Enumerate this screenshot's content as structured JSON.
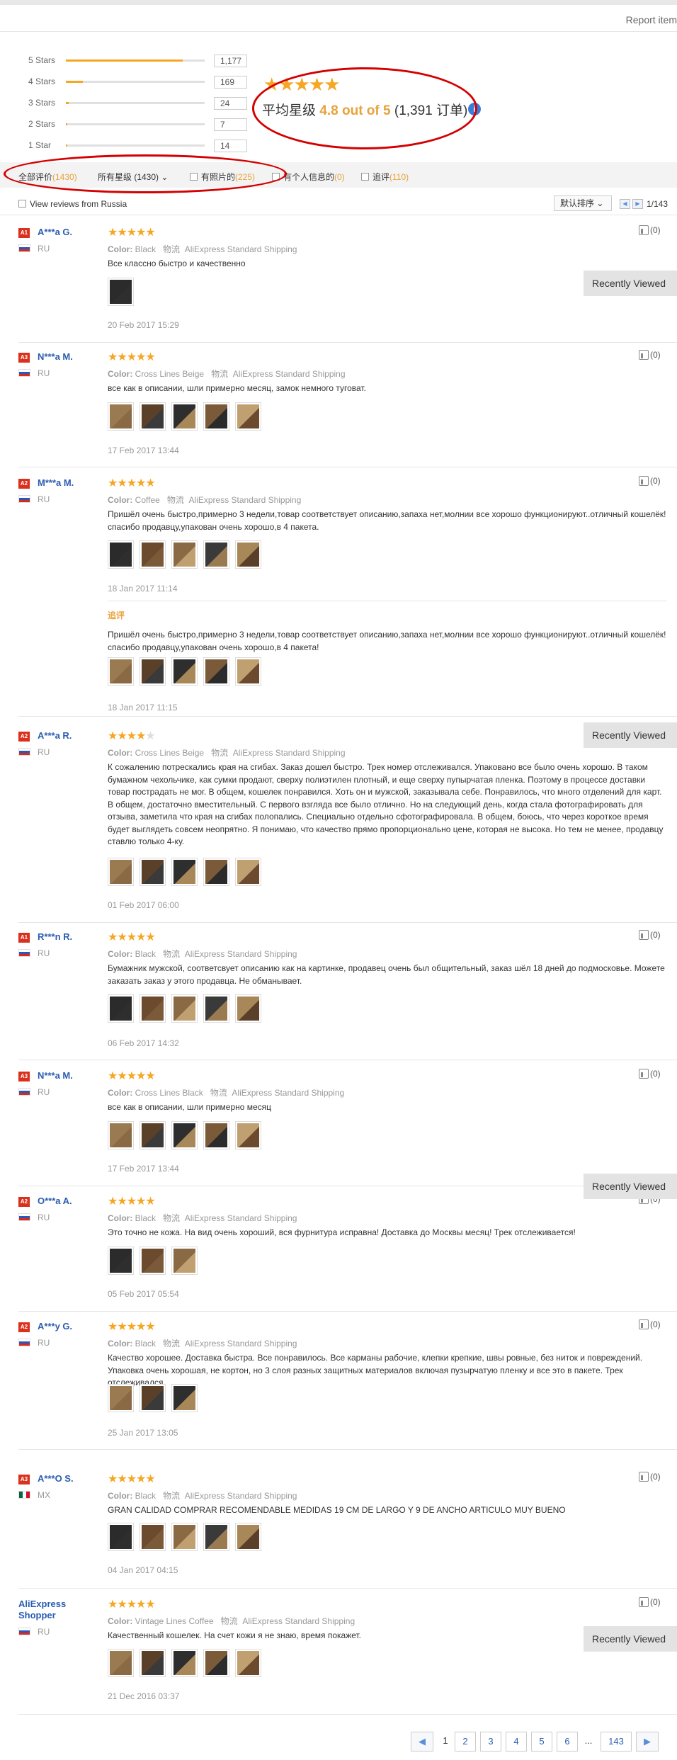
{
  "top": {
    "report_label": "Report item"
  },
  "breakdown": [
    {
      "label": "5 Stars",
      "count": "1,177",
      "ratio": 0.84
    },
    {
      "label": "4 Stars",
      "count": "169",
      "ratio": 0.12
    },
    {
      "label": "3 Stars",
      "count": "24",
      "ratio": 0.02
    },
    {
      "label": "2 Stars",
      "count": "7",
      "ratio": 0.01
    },
    {
      "label": "1 Star",
      "count": "14",
      "ratio": 0.01
    }
  ],
  "summary": {
    "stars": "★★★★★",
    "label": "平均星级",
    "score": "4.8 out of 5",
    "orders": "(1,391 订单)",
    "info_icon": "i"
  },
  "filters": {
    "all_label": "全部评价",
    "all_count": "(1430)",
    "stars_select": "所有星级 (1430)",
    "photo_label": "有照片的",
    "photo_count": "(225)",
    "personal_label": "有个人信息的",
    "personal_count": "(0)",
    "additional_label": "追评",
    "additional_count": "(110)",
    "russia_label": "View reviews from Russia",
    "sort_label": "默认排序",
    "page_info": "1/143"
  },
  "colors": {
    "star": "#f5a623",
    "link": "#2a5db0",
    "badge": "#d9311d",
    "highlight": "#d40000"
  },
  "recently_viewed": "Recently Viewed",
  "reviews": [
    {
      "level": "A1",
      "name": "A***a G.",
      "country": "RU",
      "stars": "★★★★★",
      "off_stars": "",
      "color_label": "Color:",
      "color": "Black",
      "shipping_label": "物流",
      "shipping": "AliExpress Standard Shipping",
      "text": "Все классно быстро и качественно",
      "date": "20 Feb 2017 15:29",
      "helpful": "(0)",
      "thumbs": 1
    },
    {
      "level": "A3",
      "name": "N***a M.",
      "country": "RU",
      "stars": "★★★★★",
      "off_stars": "",
      "color_label": "Color:",
      "color": "Cross Lines Beige",
      "shipping_label": "物流",
      "shipping": "AliExpress Standard Shipping",
      "text": "все как в описании, шли примерно месяц, замок немного туговат.",
      "date": "17 Feb 2017 13:44",
      "helpful": "(0)",
      "thumbs": 5
    },
    {
      "level": "A2",
      "name": "M***a M.",
      "country": "RU",
      "stars": "★★★★★",
      "off_stars": "",
      "color_label": "Color:",
      "color": "Coffee",
      "shipping_label": "物流",
      "shipping": "AliExpress Standard Shipping",
      "text": "Пришёл очень быстро,примерно 3 недели,товар соответствует описанию,запаха нет,молнии все хорошо функционируют..отличный кошелёк!спасибо продавцу,упакован очень хорошо,в 4 пакета.",
      "date": "18 Jan 2017 11:14",
      "helpful": "(0)",
      "thumbs": 5,
      "additional_label": "追评",
      "additional_text": "Пришёл очень быстро,примерно 3 недели,товар соответствует описанию,запаха нет,молнии все хорошо функционируют..отличный кошелёк!спасибо продавцу,упакован очень хорошо,в 4 пакета!",
      "additional_date": "18 Jan 2017 11:15"
    },
    {
      "level": "A2",
      "name": "A***a R.",
      "country": "RU",
      "stars": "★★★★",
      "off_stars": "★",
      "color_label": "Color:",
      "color": "Cross Lines Beige",
      "shipping_label": "物流",
      "shipping": "AliExpress Standard Shipping",
      "text": "К сожалению потрескались края на сгибах. Заказ дошел быстро. Трек номер отслеживался. Упаковано все было очень хорошо. В таком бумажном чехольчике, как сумки продают, сверху полиэтилен плотный, и еще сверху пупырчатая пленка. Поэтому в процессе доставки товар пострадать не мог. В общем, кошелек понравился. Хоть он и мужской, заказывала себе. Понравилось, что много отделений для карт. В общем, достаточно вместительный. С первого взгляда все было отлично. Но на следующий день, когда стала фотографировать для отзыва, заметила что края на сгибах полопались. Специально отдельно сфотографировала. В общем, боюсь, что через короткое время будет выглядеть совсем неопрятно. Я понимаю, что качество прямо пропорционально цене, которая не высока. Но тем не менее, продавцу ставлю только 4-ку.",
      "date": "01 Feb 2017 06:00",
      "helpful": "",
      "thumbs": 5
    },
    {
      "level": "A1",
      "name": "R***n R.",
      "country": "RU",
      "stars": "★★★★★",
      "off_stars": "",
      "color_label": "Color:",
      "color": "Black",
      "shipping_label": "物流",
      "shipping": "AliExpress Standard Shipping",
      "text": "Бумажник мужской, соответсвует описанию как на картинке, продавец очень был общительный, заказ шёл 18 дней до подмосковье. Можете заказать заказ у этого продавца. Не обманывает.",
      "date": "06 Feb 2017 14:32",
      "helpful": "(0)",
      "thumbs": 5
    },
    {
      "level": "A3",
      "name": "N***a M.",
      "country": "RU",
      "stars": "★★★★★",
      "off_stars": "",
      "color_label": "Color:",
      "color": "Cross Lines Black",
      "shipping_label": "物流",
      "shipping": "AliExpress Standard Shipping",
      "text": "все как в описании, шли примерно месяц",
      "date": "17 Feb 2017 13:44",
      "helpful": "(0)",
      "thumbs": 5
    },
    {
      "level": "A2",
      "name": "O***a A.",
      "country": "RU",
      "stars": "★★★★★",
      "off_stars": "",
      "color_label": "Color:",
      "color": "Black",
      "shipping_label": "物流",
      "shipping": "AliExpress Standard Shipping",
      "text": "Это точно не кожа. На вид очень хороший, вся фурнитура исправна! Доставка до Москвы месяц! Трек отслеживается!",
      "date": "05 Feb 2017 05:54",
      "helpful": "(0)",
      "thumbs": 3
    },
    {
      "level": "A2",
      "name": "A***y G.",
      "country": "RU",
      "stars": "★★★★★",
      "off_stars": "",
      "color_label": "Color:",
      "color": "Black",
      "shipping_label": "物流",
      "shipping": "AliExpress Standard Shipping",
      "text": "Качество хорошее. Доставка быстра. Все понравилось. Все карманы рабочие, клепки крепкие, швы ровные, без ниток и повреждений. Упаковка очень хорошая, не кортон, но 3 слоя разных защитных материалов включая пузырчатую пленку и все это в пакете. Трек отслеживался",
      "date": "25 Jan 2017 13:05",
      "helpful": "(0)",
      "thumbs": 3
    },
    {
      "level": "A3",
      "name": "A***O S.",
      "country": "MX",
      "stars": "★★★★★",
      "off_stars": "",
      "color_label": "Color:",
      "color": "Black",
      "shipping_label": "物流",
      "shipping": "AliExpress Standard Shipping",
      "text": "GRAN CALIDAD COMPRAR RECOMENDABLE MEDIDAS 19 CM DE LARGO Y 9 DE ANCHO ARTICULO MUY BUENO",
      "date": "04 Jan 2017 04:15",
      "helpful": "(0)",
      "thumbs": 5
    },
    {
      "level": "",
      "name": "AliExpress Shopper",
      "country": "RU",
      "stars": "★★★★★",
      "off_stars": "",
      "color_label": "Color:",
      "color": "Vintage Lines Coffee",
      "shipping_label": "物流",
      "shipping": "AliExpress Standard Shipping",
      "text": "Качественный кошелек. На счет кожи я не знаю, время покажет.",
      "date": "21 Dec 2016 03:37",
      "helpful": "(0)",
      "thumbs": 5
    }
  ],
  "pagination": {
    "prev": "◀",
    "pages": [
      "1",
      "2",
      "3",
      "4",
      "5",
      "6"
    ],
    "dots": "...",
    "last": "143",
    "next": "▶"
  }
}
